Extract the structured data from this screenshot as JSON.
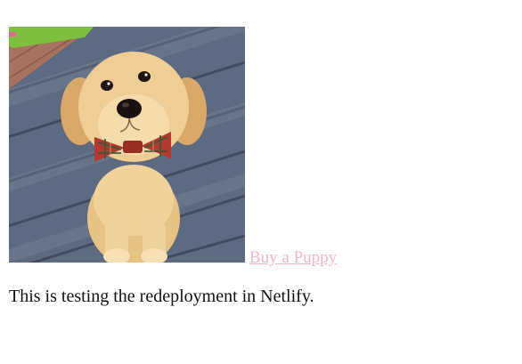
{
  "photo": {
    "subject": "golden-retriever-puppy-with-plaid-bow-tie"
  },
  "link": {
    "label": "Buy a Puppy",
    "color": "#f4b6c6"
  },
  "caption": {
    "text": "This is testing the redeployment in Netlify."
  }
}
